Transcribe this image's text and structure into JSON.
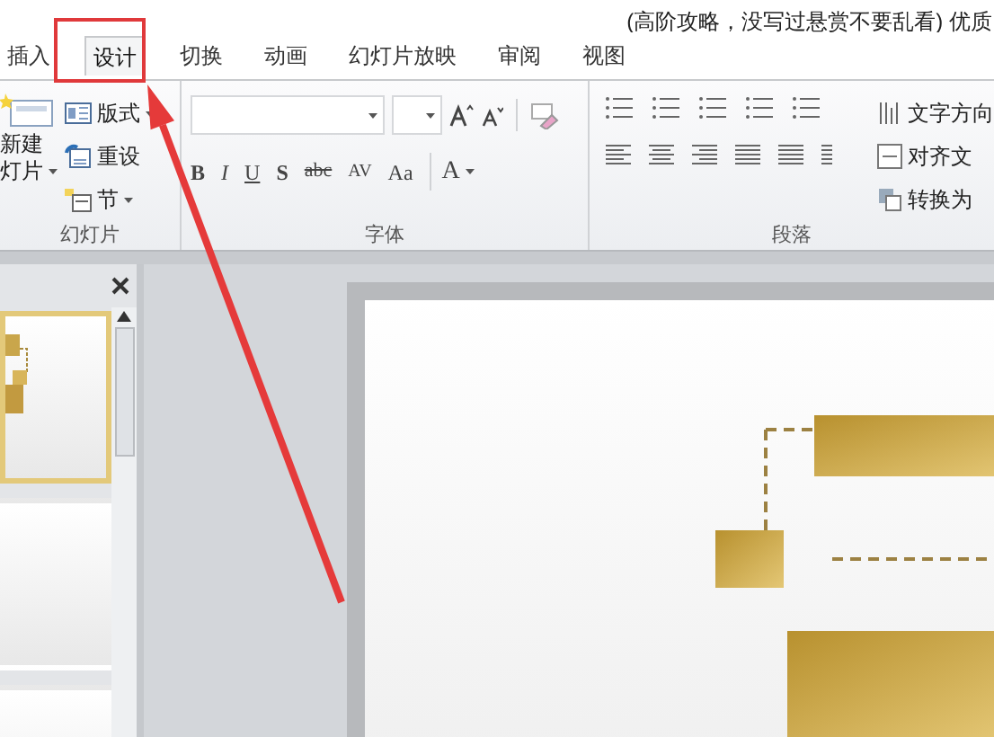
{
  "header_note": "(高阶攻略，没写过悬赏不要乱看) 优质",
  "tabs": [
    {
      "label": "插入",
      "selected": false
    },
    {
      "label": "设计",
      "selected": true
    },
    {
      "label": "切换",
      "selected": false
    },
    {
      "label": "动画",
      "selected": false
    },
    {
      "label": "幻灯片放映",
      "selected": false
    },
    {
      "label": "审阅",
      "selected": false
    },
    {
      "label": "视图",
      "selected": false
    }
  ],
  "slides_group": {
    "label": "幻灯片",
    "new_slide": [
      "新建",
      "灯片"
    ],
    "layout": "版式",
    "reset": "重设",
    "section": "节"
  },
  "font_group": {
    "label": "字体",
    "format_buttons": [
      "B",
      "I",
      "U",
      "S",
      "abc",
      "AV",
      "Aa"
    ],
    "font_color": "A"
  },
  "paragraph_group": {
    "label": "段落",
    "side_buttons": [
      "文字方向",
      "对齐文",
      "转换为"
    ]
  },
  "slides_pane": {
    "thumbnails": [
      {
        "selected": true
      },
      {
        "selected": false
      },
      {
        "selected": false
      }
    ]
  }
}
